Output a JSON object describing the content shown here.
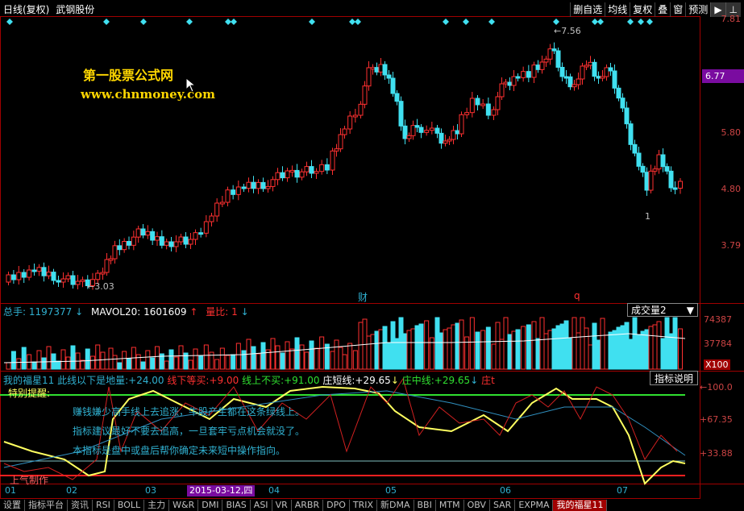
{
  "header": {
    "title": "日线(复权)",
    "stock_name": "武钢股份"
  },
  "toolbar": {
    "items": [
      "删自选",
      "均线",
      "复权",
      "叠",
      "窗",
      "预测"
    ],
    "arrow": "▶",
    "pin": "⊥"
  },
  "price_axis": {
    "ticks": [
      "7.81",
      "6.77",
      "5.80",
      "4.80",
      "3.79"
    ],
    "current": "6.77"
  },
  "annotations": {
    "high": "7.56",
    "low": "3.03",
    "low_marker": "1",
    "event1": "财",
    "event2": "q"
  },
  "watermark": {
    "line1": "第一股票公式网",
    "line2": "www.chnmoney.com"
  },
  "volume_panel": {
    "label1": "总手:",
    "value1": "1197377",
    "label2": "MAVOL20:",
    "value2": "1601609",
    "label3": "量比:",
    "value3": "1",
    "selector": "成交量2",
    "axis": [
      "74387",
      "37784",
      "X100"
    ]
  },
  "indicator_panel": {
    "name": "我的福星11",
    "desc1_label": "此线以下是地量:",
    "desc1_value": "+24.00",
    "desc2_label": "线下等买:",
    "desc2_value": "+9.00",
    "desc3_label": "线上不买:",
    "desc3_value": "+91.00",
    "desc4_label": "庄短线:",
    "desc4_value": "+29.65",
    "desc5_label": "庄中线:",
    "desc5_value": "+29.65",
    "desc6_label": "庄t",
    "button": "指标说明",
    "axis": [
      "100.0",
      "67.35",
      "33.88"
    ],
    "note_top": "特别提醒:",
    "note1": "赚钱嫌少高手线上去追涨，牛股产生都在这条绿线上。",
    "note2": "指标建议最好不要去追高，一旦套牢亏点机会就没了。",
    "note3": "本指标是盘中或盘后帮你确定未来短中操作指向。",
    "note_bottom": "上气制作"
  },
  "time_axis": {
    "months": [
      "01",
      "02",
      "03",
      "04",
      "05",
      "06",
      "07"
    ],
    "selected_date": "2015-03-12,四"
  },
  "bottom_tabs": [
    "设置",
    "指标平台",
    "资讯",
    "RSI",
    "BOLL",
    "主力",
    "W&R",
    "DMI",
    "BIAS",
    "ASI",
    "VR",
    "ARBR",
    "DPO",
    "TRIX",
    "新DMA",
    "BBI",
    "MTM",
    "OBV",
    "SAR",
    "EXPMA",
    "我的福星11"
  ],
  "colors": {
    "up": "#ff3030",
    "down": "#40e0f0",
    "yellow": "#ffff60",
    "green": "#30e030",
    "purple": "#7a0ca0"
  }
}
